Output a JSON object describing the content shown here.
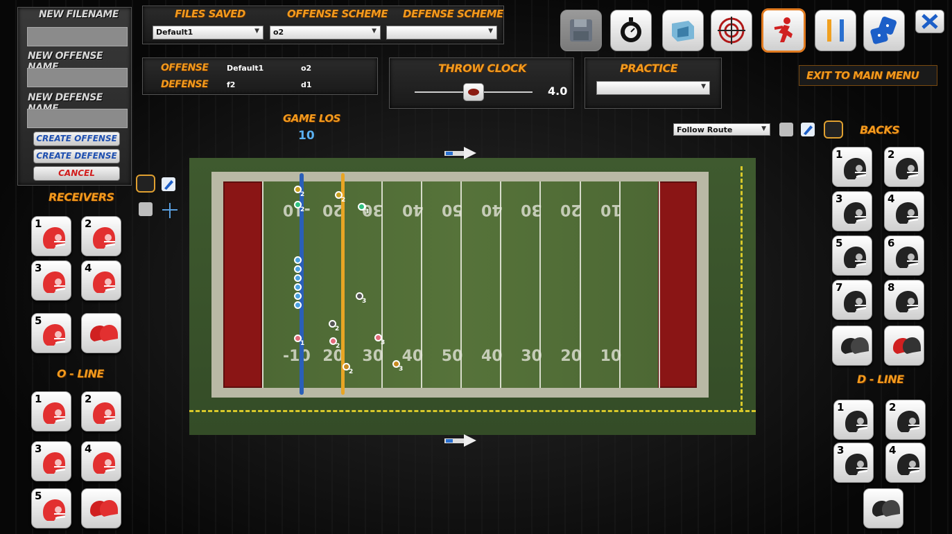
{
  "left_panel": {
    "new_filename_label": "NEW FILENAME",
    "new_offense_label": "NEW OFFENSE NAME",
    "new_defense_label": "NEW DEFENSE NAME",
    "create_offense": "CREATE OFFENSE",
    "create_defense": "CREATE DEFENSE",
    "cancel": "CANCEL",
    "receivers_label": "RECEIVERS",
    "oline_label": "O - LINE"
  },
  "top": {
    "files_saved_label": "FILES SAVED",
    "files_saved_value": "Default1",
    "offense_scheme_label": "OFFENSE SCHEME",
    "offense_scheme_value": "o2",
    "defense_scheme_label": "DEFENSE SCHEME",
    "defense_scheme_value": "",
    "offense_label": "OFFENSE",
    "offense_file": "Default1",
    "offense_scheme": "o2",
    "defense_label": "DEFENSE",
    "defense_file": "f2",
    "defense_scheme": "d1",
    "throw_clock_label": "THROW CLOCK",
    "throw_clock_value": "4.0",
    "throw_clock_fraction": 0.5,
    "practice_label": "PRACTICE",
    "practice_value": "",
    "exit_label": "EXIT TO MAIN MENU"
  },
  "field": {
    "game_los_label": "GAME LOS",
    "game_los_value": "10",
    "follow_route_value": "Follow Route",
    "yard_numbers_top": [
      "-10",
      "20",
      "30",
      "40",
      "50",
      "40",
      "30",
      "20",
      "10"
    ],
    "yard_numbers_bottom": [
      "-10",
      "20",
      "30",
      "40",
      "50",
      "40",
      "30",
      "20",
      "10"
    ]
  },
  "right_panel": {
    "backs_label": "BACKS",
    "dline_label": "D - LINE"
  },
  "receivers": [
    "1",
    "2",
    "3",
    "4",
    "5"
  ],
  "oline": [
    "1",
    "2",
    "3",
    "4",
    "5"
  ],
  "backs": [
    "1",
    "2",
    "3",
    "4",
    "5",
    "6",
    "7",
    "8"
  ],
  "dline": [
    "1",
    "2",
    "3",
    "4"
  ],
  "players": {
    "offense_labels": [
      "1",
      "2",
      "3",
      "2",
      "3"
    ],
    "defense_labels": [
      "2",
      "2",
      "2",
      "3",
      "2",
      "3"
    ]
  },
  "colors": {
    "accent_orange": "#f39a1d",
    "los_blue": "#2a5fb8",
    "los_yellow": "#e8a524",
    "endzone": "#8a1515"
  },
  "icons": [
    "save-icon",
    "stopwatch-icon",
    "formation-icon",
    "target-icon",
    "runner-icon",
    "pause-icon",
    "dice-icon",
    "close-icon"
  ]
}
